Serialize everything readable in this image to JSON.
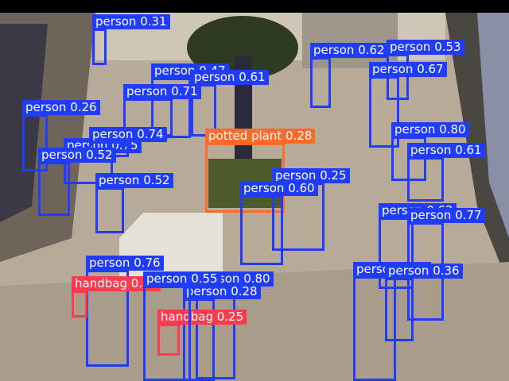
{
  "colors": {
    "person": "#1f3cff",
    "potted plant": "#ff6a2b",
    "handbag": "#ff3b4e"
  },
  "detections": [
    {
      "label": "person",
      "score": "0.31"
    },
    {
      "label": "person",
      "score": "0.47"
    },
    {
      "label": "person",
      "score": "0.61"
    },
    {
      "label": "person",
      "score": "0.71"
    },
    {
      "label": "person",
      "score": "0.26"
    },
    {
      "label": "person",
      "score": "0.75"
    },
    {
      "label": "person",
      "score": "0.74"
    },
    {
      "label": "person",
      "score": "0.52"
    },
    {
      "label": "person",
      "score": "0.52"
    },
    {
      "label": "potted plant",
      "score": "0.28"
    },
    {
      "label": "person",
      "score": "0.25"
    },
    {
      "label": "person",
      "score": "0.60"
    },
    {
      "label": "person",
      "score": "0.62"
    },
    {
      "label": "person",
      "score": "0.53"
    },
    {
      "label": "person",
      "score": "0.67"
    },
    {
      "label": "person",
      "score": "0.80"
    },
    {
      "label": "person",
      "score": "0.61"
    },
    {
      "label": "person",
      "score": "0.62"
    },
    {
      "label": "person",
      "score": "0.77"
    },
    {
      "label": "person",
      "score": "0.65"
    },
    {
      "label": "person",
      "score": "0.36"
    },
    {
      "label": "person",
      "score": "0.76"
    },
    {
      "label": "handbag",
      "score": "0.40"
    },
    {
      "label": "person",
      "score": "0.80"
    },
    {
      "label": "person",
      "score": "0.28"
    },
    {
      "label": "handbag",
      "score": "0.25"
    },
    {
      "label": "person",
      "score": "0.55"
    }
  ]
}
